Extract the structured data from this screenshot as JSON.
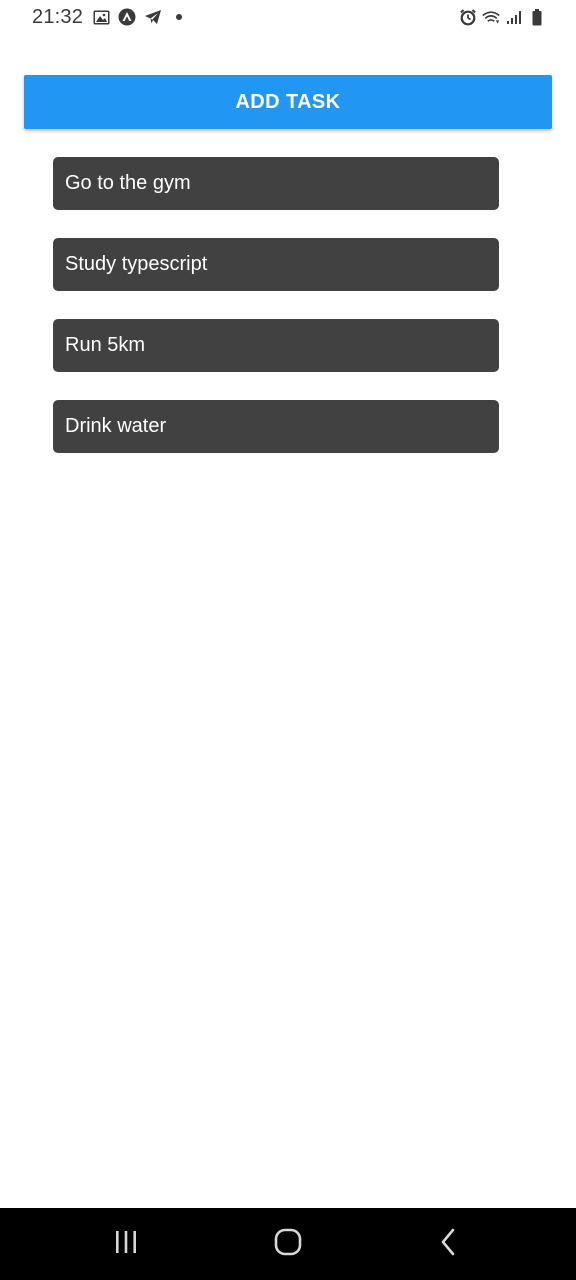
{
  "status_bar": {
    "time": "21:32",
    "left_icons": [
      "gallery-icon",
      "app-circle-icon",
      "telegram-icon",
      "dot-icon"
    ],
    "right_icons": [
      "alarm-icon",
      "wifi-icon",
      "signal-icon",
      "battery-icon"
    ]
  },
  "toolbar": {
    "add_task_label": "ADD TASK"
  },
  "tasks": [
    {
      "label": "Go to the gym"
    },
    {
      "label": "Study typescript"
    },
    {
      "label": "Run 5km"
    },
    {
      "label": "Drink water"
    }
  ],
  "nav_bar": {
    "buttons": [
      "recent-apps-icon",
      "home-icon",
      "back-icon"
    ]
  },
  "colors": {
    "accent": "#2196f3",
    "task_background": "#414141",
    "nav_background": "#000000"
  }
}
